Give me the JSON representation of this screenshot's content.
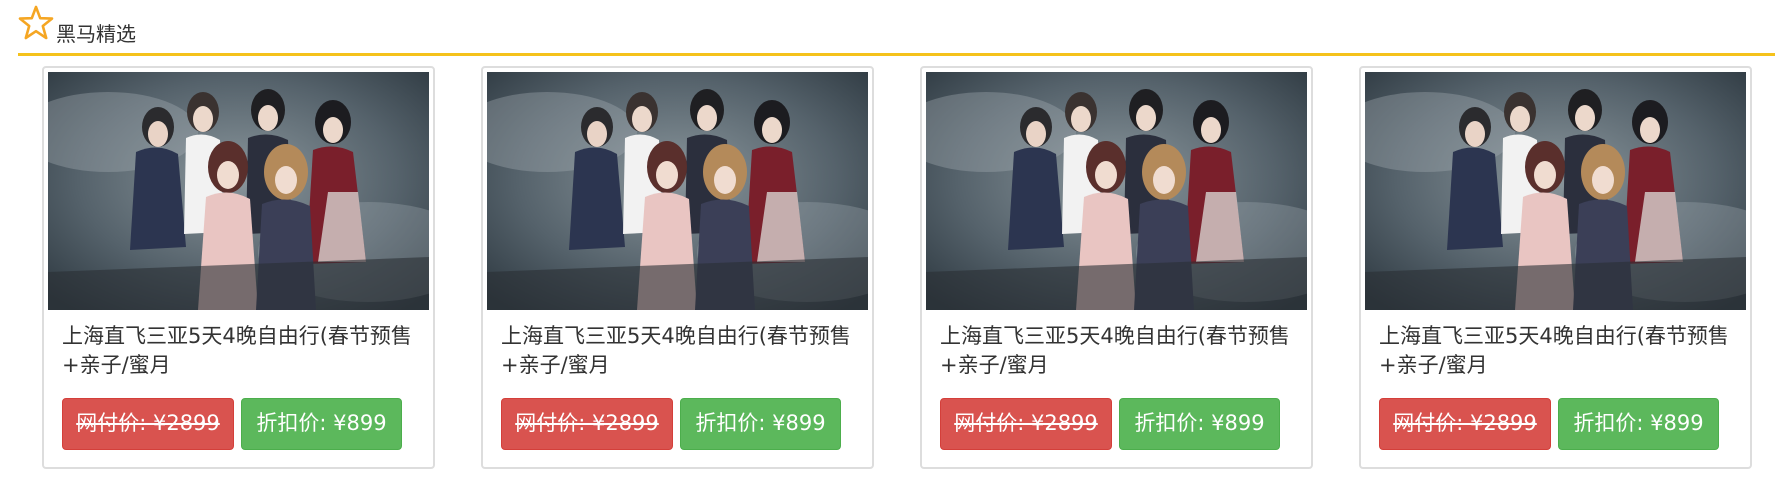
{
  "section": {
    "title": "黑马精选",
    "icon": "star-outline-icon",
    "accent_color": "#f5c21b"
  },
  "products": [
    {
      "image": "girl-group-photo",
      "title": "上海直飞三亚5天4晚自由行(春节预售+亲子/蜜月",
      "web_price": "网付价: ¥2899",
      "discount_price": "折扣价: ¥899"
    },
    {
      "image": "girl-group-photo",
      "title": "上海直飞三亚5天4晚自由行(春节预售+亲子/蜜月",
      "web_price": "网付价: ¥2899",
      "discount_price": "折扣价: ¥899"
    },
    {
      "image": "girl-group-photo",
      "title": "上海直飞三亚5天4晚自由行(春节预售+亲子/蜜月",
      "web_price": "网付价: ¥2899",
      "discount_price": "折扣价: ¥899"
    },
    {
      "image": "girl-group-photo",
      "title": "上海直飞三亚5天4晚自由行(春节预售+亲子/蜜月",
      "web_price": "网付价: ¥2899",
      "discount_price": "折扣价: ¥899"
    }
  ],
  "colors": {
    "web_price_button": "#d9534f",
    "discount_button": "#5cb85c"
  }
}
